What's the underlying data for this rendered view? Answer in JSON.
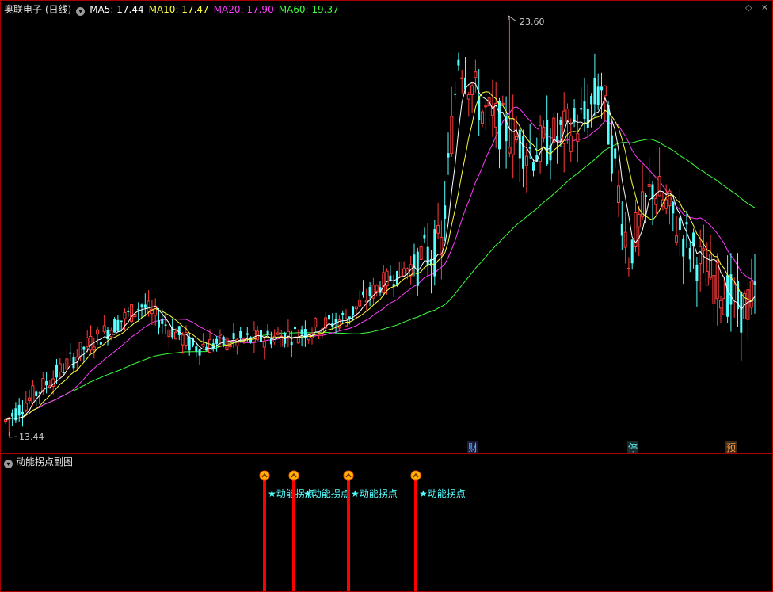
{
  "header": {
    "stock": "奥联电子 (日线)",
    "ma5": "MA5: 17.44",
    "ma10": "MA10: 17.47",
    "ma20": "MA20: 17.90",
    "ma60": "MA60: 19.37"
  },
  "sub_panel": {
    "title": "动能拐点副图",
    "signal_label": "★动能拐点"
  },
  "markers": {
    "cai": "财",
    "ting": "停",
    "yu": "预"
  },
  "colors": {
    "up": "#ff3c3c",
    "down": "#54ffff",
    "ma5": "#ffffff",
    "ma10": "#ffff3c",
    "ma20": "#ff3cff",
    "ma60": "#3cff3c",
    "frame": "#aa0000",
    "signal": "#ff0000"
  },
  "chart_data": {
    "type": "candlestick",
    "price_labels": {
      "high": "23.60",
      "low": "13.44"
    },
    "y_range": [
      13.44,
      23.6
    ],
    "indicators": [
      "MA5",
      "MA10",
      "MA20",
      "MA60"
    ],
    "signals": [
      "★动能拐点",
      "★动能拐点",
      "★动能拐点",
      "★动能拐点"
    ]
  }
}
